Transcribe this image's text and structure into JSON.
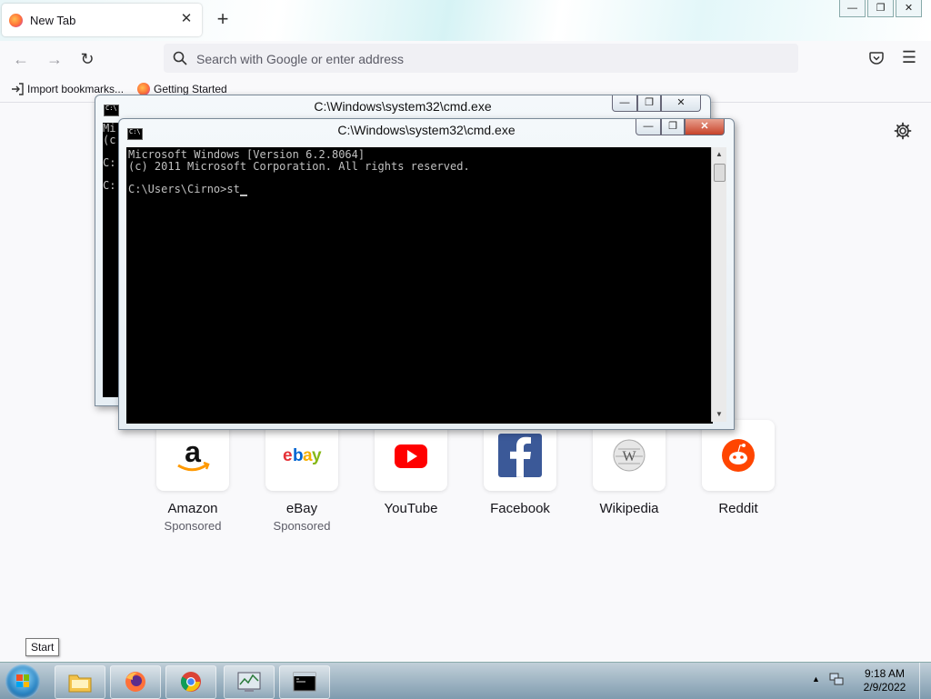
{
  "browser": {
    "tab_title": "New Tab",
    "tab_close": "✕",
    "new_tab": "+",
    "window_controls": {
      "minimize": "—",
      "maximize": "❐",
      "close": "✕"
    },
    "nav": {
      "back": "←",
      "forward": "→",
      "reload": "↻"
    },
    "search_placeholder": "Search with Google or enter address",
    "menu": "☰",
    "bookmarks": [
      {
        "label": "Import bookmarks...",
        "icon": "import-icon"
      },
      {
        "label": "Getting Started",
        "icon": "firefox-icon"
      }
    ]
  },
  "shortcuts": [
    {
      "name": "Amazon",
      "sponsored": "Sponsored",
      "icon": "amazon-icon"
    },
    {
      "name": "eBay",
      "sponsored": "Sponsored",
      "icon": "ebay-icon"
    },
    {
      "name": "YouTube",
      "sponsored": "",
      "icon": "youtube-icon"
    },
    {
      "name": "Facebook",
      "sponsored": "",
      "icon": "facebook-icon"
    },
    {
      "name": "Wikipedia",
      "sponsored": "",
      "icon": "wikipedia-icon"
    },
    {
      "name": "Reddit",
      "sponsored": "",
      "icon": "reddit-icon"
    }
  ],
  "cmd_back": {
    "title": "C:\\Windows\\system32\\cmd.exe",
    "visible_text": "Mi\n(c\n\nC:\n\nC:"
  },
  "cmd_front": {
    "title": "C:\\Windows\\system32\\cmd.exe",
    "lines": [
      "Microsoft Windows [Version 6.2.8064]",
      "(c) 2011 Microsoft Corporation. All rights reserved.",
      "",
      "C:\\Users\\Cirno>st"
    ],
    "buttons": {
      "minimize": "—",
      "maximize": "❐",
      "close": "✕"
    }
  },
  "taskbar": {
    "start_tooltip": "Start",
    "items": [
      "explorer",
      "firefox",
      "chrome",
      "resource-monitor",
      "cmd"
    ],
    "time": "9:18 AM",
    "date": "2/9/2022",
    "tray_up": "▲"
  },
  "colors": {
    "console_bg": "#000000",
    "console_fg": "#c0c0c0",
    "accent": "#0060df"
  }
}
